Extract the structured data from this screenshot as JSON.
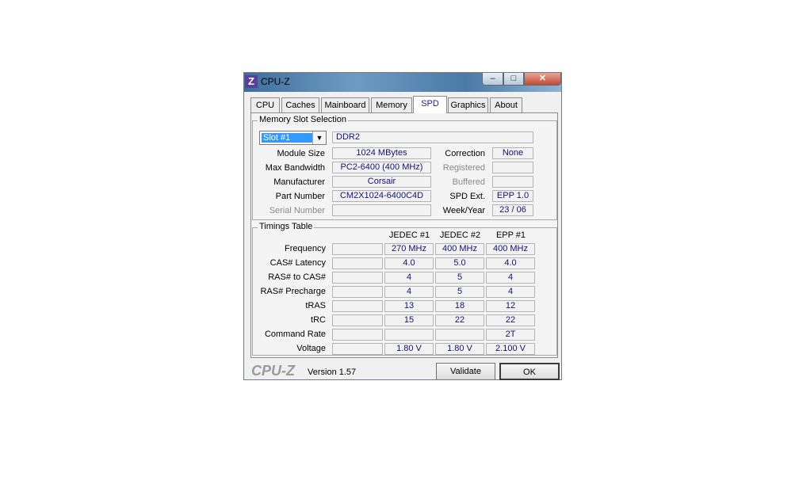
{
  "window": {
    "title": "CPU-Z",
    "icon_letter": "Z",
    "min_glyph": "–",
    "max_glyph": "□",
    "close_glyph": "✕"
  },
  "tabs": [
    "CPU",
    "Caches",
    "Mainboard",
    "Memory",
    "SPD",
    "Graphics",
    "About"
  ],
  "active_tab": "SPD",
  "slot_group": {
    "title": "Memory Slot Selection",
    "slot_value": "Slot #1",
    "memory_type": "DDR2",
    "labels": {
      "module_size": "Module Size",
      "max_bandwidth": "Max Bandwidth",
      "manufacturer": "Manufacturer",
      "part_number": "Part Number",
      "serial_number": "Serial Number",
      "correction": "Correction",
      "registered": "Registered",
      "buffered": "Buffered",
      "spd_ext": "SPD Ext.",
      "week_year": "Week/Year"
    },
    "values": {
      "module_size": "1024 MBytes",
      "max_bandwidth": "PC2-6400 (400 MHz)",
      "manufacturer": "Corsair",
      "part_number": "CM2X1024-6400C4D",
      "serial_number": "",
      "correction": "None",
      "registered": "",
      "buffered": "",
      "spd_ext": "EPP 1.0",
      "week_year": "23 / 06"
    }
  },
  "timings": {
    "title": "Timings Table",
    "columns": [
      "JEDEC #1",
      "JEDEC #2",
      "EPP #1"
    ],
    "rows": [
      {
        "label": "Frequency",
        "values": [
          "270 MHz",
          "400 MHz",
          "400 MHz"
        ]
      },
      {
        "label": "CAS# Latency",
        "values": [
          "4.0",
          "5.0",
          "4.0"
        ]
      },
      {
        "label": "RAS# to CAS#",
        "values": [
          "4",
          "5",
          "4"
        ]
      },
      {
        "label": "RAS# Precharge",
        "values": [
          "4",
          "5",
          "4"
        ]
      },
      {
        "label": "tRAS",
        "values": [
          "13",
          "18",
          "12"
        ]
      },
      {
        "label": "tRC",
        "values": [
          "15",
          "22",
          "22"
        ]
      },
      {
        "label": "Command Rate",
        "values": [
          "",
          "",
          "2T"
        ]
      },
      {
        "label": "Voltage",
        "values": [
          "1.80 V",
          "1.80 V",
          "2.100 V"
        ]
      }
    ]
  },
  "footer": {
    "logo": "CPU-Z",
    "version": "Version 1.57",
    "validate_label": "Validate",
    "ok_label": "OK"
  }
}
